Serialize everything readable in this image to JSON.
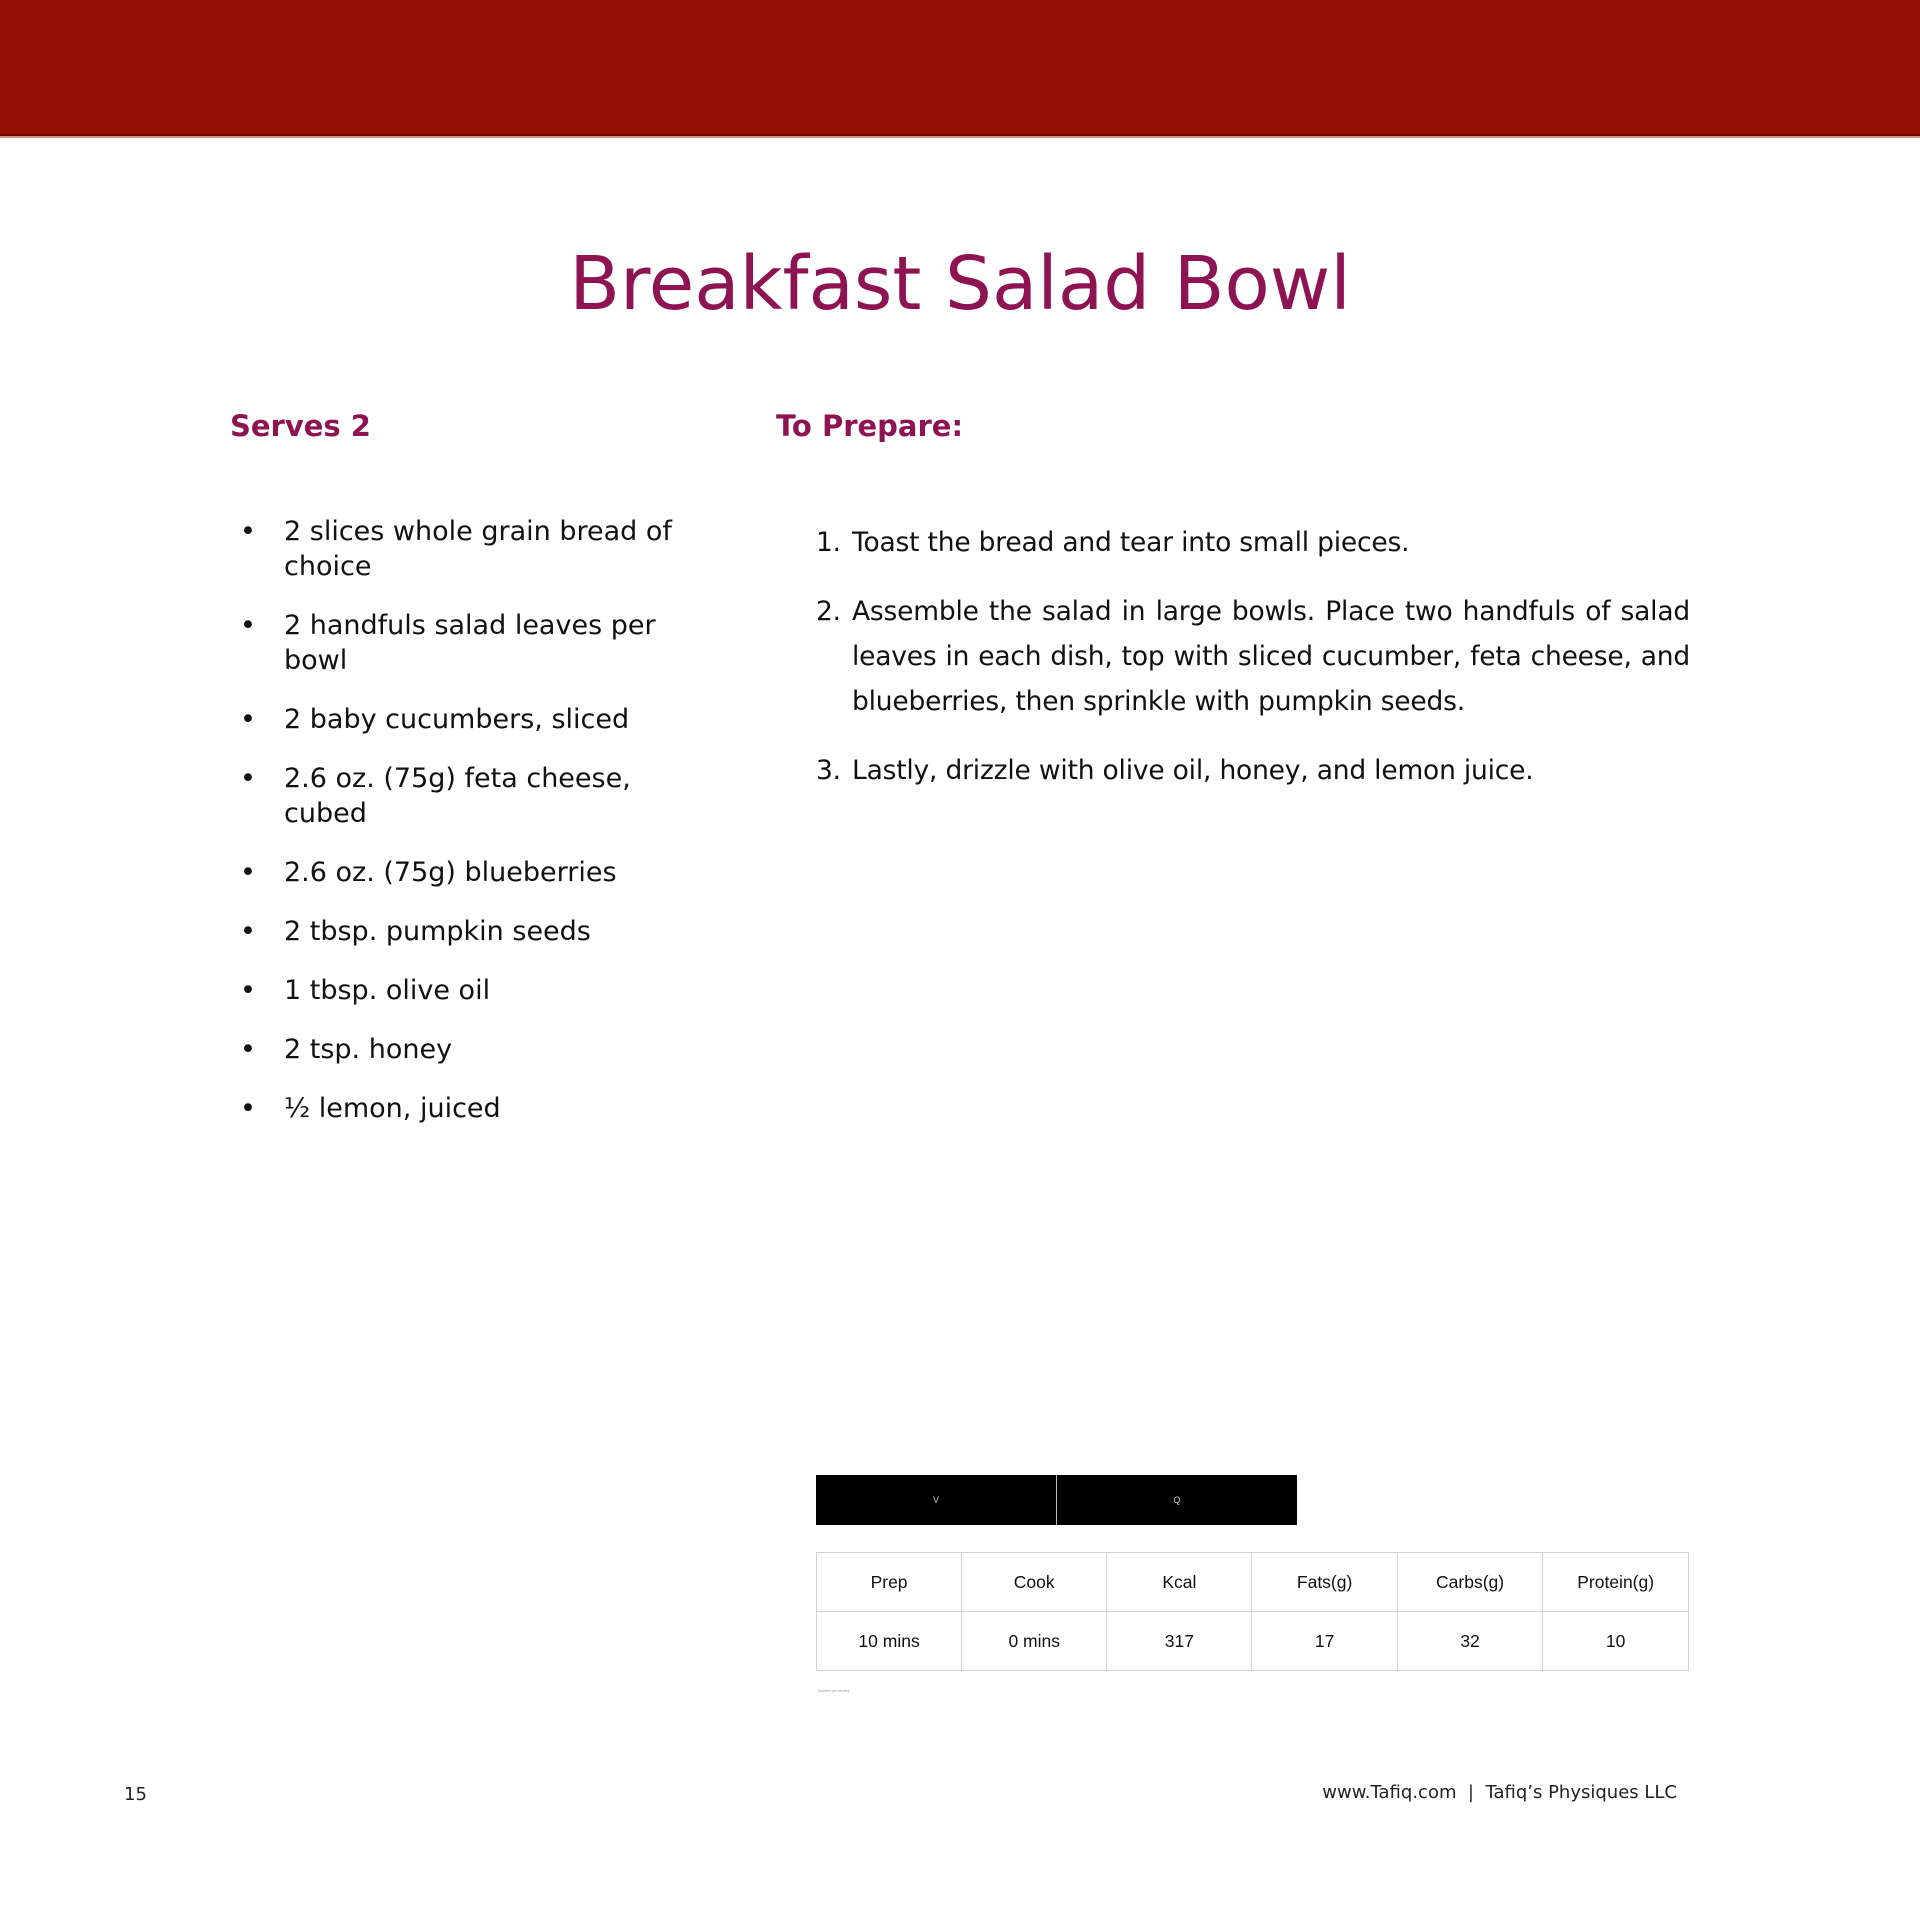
{
  "header": {
    "band_color": "#941000"
  },
  "recipe": {
    "title": "Breakfast Salad Bowl",
    "accent_color": "#8e1352",
    "serves_label": "Serves 2",
    "prepare_label": "To Prepare:",
    "ingredients": [
      "2 slices whole grain bread of choice",
      "2 handfuls salad leaves per bowl",
      "2 baby cucumbers, sliced",
      "2.6 oz. (75g) feta cheese, cubed",
      "2.6 oz. (75g) blueberries",
      "2 tbsp. pumpkin seeds",
      "1 tbsp. olive oil",
      "2 tsp. honey",
      "½ lemon, juiced"
    ],
    "bullet_glyph": "•",
    "steps": [
      {
        "num": "1.",
        "text": "Toast the bread and tear into small pieces."
      },
      {
        "num": "2.",
        "text": "Assemble the salad in large bowls. Place two handfuls of salad leaves in each dish, top with sliced cucumber, feta cheese, and blueberries, then sprinkle with pumpkin seeds."
      },
      {
        "num": "3.",
        "text": "Lastly, drizzle with olive oil, honey, and lemon juice."
      }
    ]
  },
  "diet_badges": [
    {
      "label": "V",
      "icon": "vegetarian-icon"
    },
    {
      "label": "Q",
      "icon": "quick-icon"
    }
  ],
  "nutrition": {
    "headers": [
      "Prep",
      "Cook",
      "Kcal",
      "Fats(g)",
      "Carbs(g)",
      "Protein(g)"
    ],
    "values": [
      "10 mins",
      "0 mins",
      "317",
      "17",
      "32",
      "10"
    ],
    "note": "Nutrition per serving"
  },
  "footer": {
    "page_number": "15",
    "credit": "www.Tafiq.com  |  Tafiq’s Physiques LLC"
  }
}
